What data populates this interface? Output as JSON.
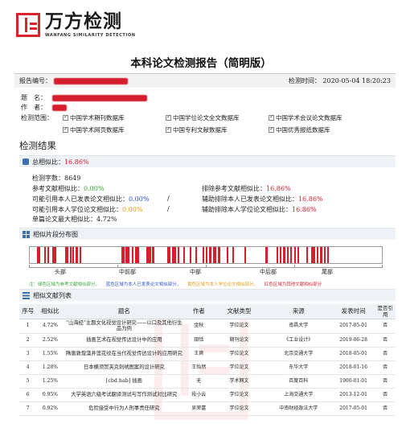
{
  "brand": {
    "name": "万方检测",
    "tagline": "WANFANG SIMILARITY DETECTION"
  },
  "report": {
    "title": "本科论文检测报告（简明版）",
    "number_label": "报告编号：",
    "number_value": "##########",
    "time_label": "检测时间：",
    "time_value": "2020-05-04 18:20:23"
  },
  "fields": {
    "title_label": "题　名：",
    "author_label": "作　者：",
    "scope_label": "检测范围："
  },
  "databases": [
    "中国学术期刊数据库",
    "中国学位论文全文数据库",
    "中国学术会议论文数据库",
    "中国学术网页数据库",
    "中国专利文献数据库",
    "中国优秀报纸数据库"
  ],
  "results": {
    "heading": "检测结果",
    "total_label": "总相似比：",
    "total_value": "16.86%",
    "word_count_label": "检测字数：",
    "word_count_value": "8649",
    "ref_sim_label": "参考文献相似比：",
    "ref_sim_value": "0.00%",
    "excl_ref_label": "排除参考文献相似比：",
    "excl_ref_value": "16.86%",
    "self_pub_label": "可能引用本人已发表论文相似比：",
    "self_pub_value": "0.00%",
    "aux_excl_pub_label": "辅助排除本人已发表论文相似比：",
    "aux_excl_pub_value": "16.86%",
    "self_thesis_label": "可能引用本人学位论文相似比：",
    "self_thesis_value": "0.00%",
    "aux_excl_thesis_label": "辅助排除本人学位论文相似比：",
    "aux_excl_thesis_value": "16.86%",
    "single_max_label": "单篇论文最大相似比：",
    "single_max_value": "4.72%",
    "sep": "/"
  },
  "distribution": {
    "heading": "相似片段分布图",
    "sections": [
      "头部",
      "中前部",
      "中部",
      "中后部",
      "尾部"
    ],
    "segments": [
      [
        0.02,
        0.03
      ],
      [
        0.04,
        0.045
      ],
      [
        0.05,
        0.055
      ],
      [
        0.065,
        0.075
      ],
      [
        0.1,
        0.11
      ],
      [
        0.115,
        0.118
      ],
      [
        0.12,
        0.125
      ],
      [
        0.13,
        0.138
      ],
      [
        0.142,
        0.146
      ],
      [
        0.26,
        0.27
      ],
      [
        0.272,
        0.282
      ],
      [
        0.29,
        0.295
      ],
      [
        0.3,
        0.31
      ],
      [
        0.33,
        0.345
      ],
      [
        0.348,
        0.355
      ],
      [
        0.39,
        0.4
      ],
      [
        0.405,
        0.415
      ],
      [
        0.42,
        0.425
      ],
      [
        0.435,
        0.44
      ],
      [
        0.455,
        0.46
      ],
      [
        0.47,
        0.475
      ],
      [
        0.49,
        0.495
      ],
      [
        0.5,
        0.505
      ],
      [
        0.51,
        0.515
      ],
      [
        0.52,
        0.53
      ],
      [
        0.535,
        0.54
      ],
      [
        0.56,
        0.565
      ],
      [
        0.575,
        0.58
      ],
      [
        0.61,
        0.615
      ],
      [
        0.67,
        0.675
      ],
      [
        0.7,
        0.705
      ],
      [
        0.71,
        0.715
      ],
      [
        0.72,
        0.725
      ],
      [
        0.73,
        0.735
      ],
      [
        0.74,
        0.745
      ],
      [
        0.75,
        0.755
      ],
      [
        0.76,
        0.765
      ],
      [
        0.785,
        0.79
      ],
      [
        0.8,
        0.81
      ],
      [
        0.815,
        0.82
      ],
      [
        0.825,
        0.83
      ],
      [
        0.835,
        0.84
      ],
      [
        0.845,
        0.85
      ]
    ],
    "segment_color": "#d71f2b",
    "legend": [
      {
        "text": "注：绿色区域为参考文献相似部分，",
        "color": "#3aa63a"
      },
      {
        "text": "蓝色区域为本人已发表论文相似部分，",
        "color": "#2a52c6"
      },
      {
        "text": "黄色区域为本人学位论文相似部分，",
        "color": "#e69b16"
      },
      {
        "text": "红色区域为其他文献相似部分",
        "color": "#d71f2b"
      }
    ]
  },
  "table": {
    "heading": "相似文献列表",
    "headers": [
      "序号",
      "相似比",
      "题名",
      "作者",
      "文献类型",
      "来源",
      "发表时间",
      "是否引用"
    ],
    "rows": [
      [
        "1",
        "4.72%",
        "\"山海经\"主题文化视觉设计研究——以口及其他衍生品为例",
        "金秋",
        "学位论文",
        "南昌大学",
        "2017-05-01",
        "否"
      ],
      [
        "2",
        "2.52%",
        "插画艺术在视觉传达设计中的应用",
        "田恬",
        "期刊论文",
        "《工业设计》",
        "2019-06-28",
        "否"
      ],
      [
        "3",
        "1.55%",
        "隋唐敦煌藻井莲花纹在当代视觉传达设计的应用研究",
        "王爽",
        "学位论文",
        "北京交通大学",
        "2018-05-01",
        "否"
      ],
      [
        "4",
        "1.28%",
        "日本横须贺夹克刺绣图案的设计研究",
        "王怡然",
        "学位论文",
        "东华大学",
        "2018-01-16",
        "否"
      ],
      [
        "5",
        "1.25%",
        "[cbd hab] 插画",
        "无",
        "学术网文",
        "百度百科",
        "1900-01-01",
        "否"
      ],
      [
        "6",
        "0.95%",
        "大学英语六级考试翻译测试与写作测试对比研究",
        "段小云",
        "学位论文",
        "上海交通大学",
        "2013-12-01",
        "否"
      ],
      [
        "7",
        "0.92%",
        "危险接受中行为人刑事责任研究",
        "吴荣富",
        "学位论文",
        "中南财经政法大学",
        "2017-05-01",
        "否"
      ]
    ]
  }
}
